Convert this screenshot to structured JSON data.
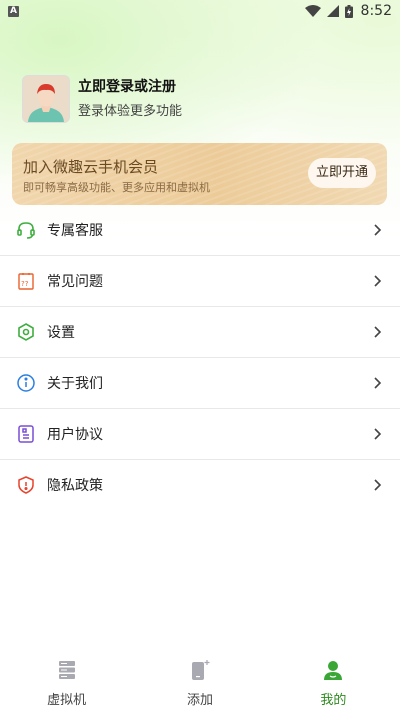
{
  "status_bar": {
    "time": "8:52",
    "notif_icon_letter": "A"
  },
  "profile": {
    "title": "立即登录或注册",
    "subtitle": "登录体验更多功能"
  },
  "vip": {
    "title": "加入微趣云手机会员",
    "subtitle": "即可畅享高级功能、更多应用和虚拟机",
    "button": "立即开通"
  },
  "menu": {
    "items": [
      {
        "label": "专属客服",
        "icon": "headset-icon",
        "color": "#3fae3f"
      },
      {
        "label": "常见问题",
        "icon": "question-icon",
        "color": "#e8622c"
      },
      {
        "label": "设置",
        "icon": "settings-icon",
        "color": "#3fae3f"
      },
      {
        "label": "关于我们",
        "icon": "info-icon",
        "color": "#2a7fe0"
      },
      {
        "label": "用户协议",
        "icon": "agreement-icon",
        "color": "#7a4fd6"
      },
      {
        "label": "隐私政策",
        "icon": "shield-icon",
        "color": "#e8432c"
      }
    ]
  },
  "tabbar": {
    "tabs": [
      {
        "label": "虚拟机",
        "icon": "server-icon"
      },
      {
        "label": "添加",
        "icon": "add-device-icon"
      },
      {
        "label": "我的",
        "icon": "profile-icon",
        "active": true
      }
    ],
    "active_color": "#2e8a1e"
  }
}
